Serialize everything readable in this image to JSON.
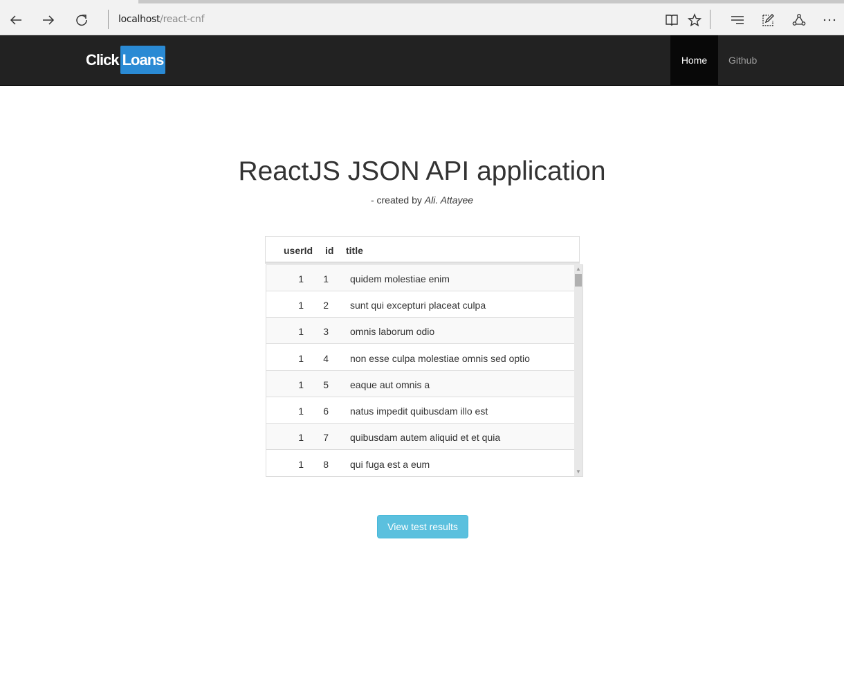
{
  "browser": {
    "address_host": "localhost",
    "address_path": "/react-cnf",
    "icons": [
      "back-arrow-icon",
      "forward-arrow-icon",
      "refresh-icon",
      "reading-view-icon",
      "favorite-star-icon",
      "hub-icon",
      "web-note-icon",
      "share-icon",
      "more-icon"
    ]
  },
  "navbar": {
    "brand_part1": "Click",
    "brand_part2": "Loans",
    "brand_color": "#2a8ad4",
    "items": [
      {
        "label": "Home",
        "active": true
      },
      {
        "label": "Github",
        "active": false
      }
    ]
  },
  "main": {
    "title": "ReactJS JSON API application",
    "subtitle_prefix": "- created by ",
    "author": "Ali. Attayee"
  },
  "table": {
    "columns": [
      "userId",
      "id",
      "title"
    ],
    "rows": [
      {
        "userId": "1",
        "id": "1",
        "title": "quidem molestiae enim"
      },
      {
        "userId": "1",
        "id": "2",
        "title": "sunt qui excepturi placeat culpa"
      },
      {
        "userId": "1",
        "id": "3",
        "title": "omnis laborum odio"
      },
      {
        "userId": "1",
        "id": "4",
        "title": "non esse culpa molestiae omnis sed optio"
      },
      {
        "userId": "1",
        "id": "5",
        "title": "eaque aut omnis a"
      },
      {
        "userId": "1",
        "id": "6",
        "title": "natus impedit quibusdam illo est"
      },
      {
        "userId": "1",
        "id": "7",
        "title": "quibusdam autem aliquid et et quia"
      },
      {
        "userId": "1",
        "id": "8",
        "title": "qui fuga est a eum"
      }
    ]
  },
  "actions": {
    "view_results_label": "View test results",
    "button_color": "#5bc0de"
  }
}
